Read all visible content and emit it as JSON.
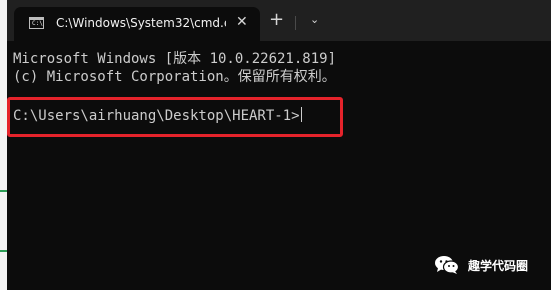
{
  "window": {
    "tab_title": "C:\\Windows\\System32\\cmd.e",
    "tab_close_glyph": "✕",
    "new_tab_glyph": "+",
    "dropdown_glyph": "⌄",
    "tab_icon_text": "C:\\"
  },
  "console": {
    "line1": "Microsoft Windows [版本 10.0.22621.819]",
    "line2": "(c) Microsoft Corporation。保留所有权利。",
    "prompt": "C:\\Users\\airhuang\\Desktop\\HEART-1>"
  },
  "colors": {
    "highlight_border": "#e5232b",
    "console_bg": "#0c0c0c",
    "console_text": "#cccccc"
  },
  "watermark": {
    "text": "趣学代码圈",
    "icon": "wechat-icon"
  }
}
